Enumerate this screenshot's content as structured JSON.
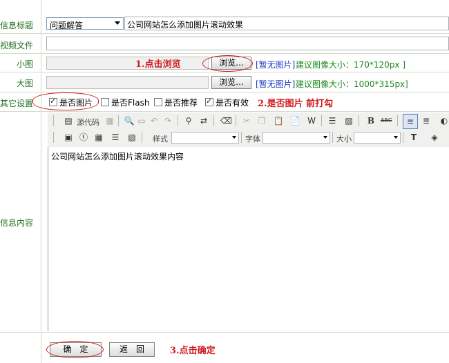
{
  "labels": {
    "info_title": "信息标题",
    "video_file": "视频文件",
    "small_image": "小图",
    "large_image": "大图",
    "other_settings": "其它设置",
    "info_content": "信息内容"
  },
  "category_select": {
    "value": "问题解答"
  },
  "title_input": {
    "value": "公司网站怎么添加图片滚动效果"
  },
  "small_image": {
    "browse_label": "浏览...",
    "no_image": "[暂无图片]",
    "hint": "建议图像大小：170*120px ]"
  },
  "large_image": {
    "browse_label": "浏览...",
    "no_image": "[暂无图片]",
    "hint": "建议图像大小：1000*315px]"
  },
  "options": [
    {
      "label": "是否图片",
      "checked": true
    },
    {
      "label": "是否Flash",
      "checked": false
    },
    {
      "label": "是否推荐",
      "checked": false
    },
    {
      "label": "是否有效",
      "checked": true
    }
  ],
  "toolbar": {
    "source_label": "源代码",
    "style_label": "样式",
    "font_label": "字体",
    "size_label": "大小",
    "bold": "B",
    "strike": "ABC"
  },
  "editor": {
    "content": "公司网站怎么添加图片滚动效果内容"
  },
  "buttons": {
    "ok": "确　定",
    "back": "返　回"
  },
  "annotations": {
    "step1": "1.点击浏览",
    "step2": "2.是否图片  前打勾",
    "step3": "3.点击确定"
  },
  "colors": {
    "label_green": "#1f6f1f",
    "annotation_red": "#d0191c",
    "link_blue": "#1d39c8"
  }
}
